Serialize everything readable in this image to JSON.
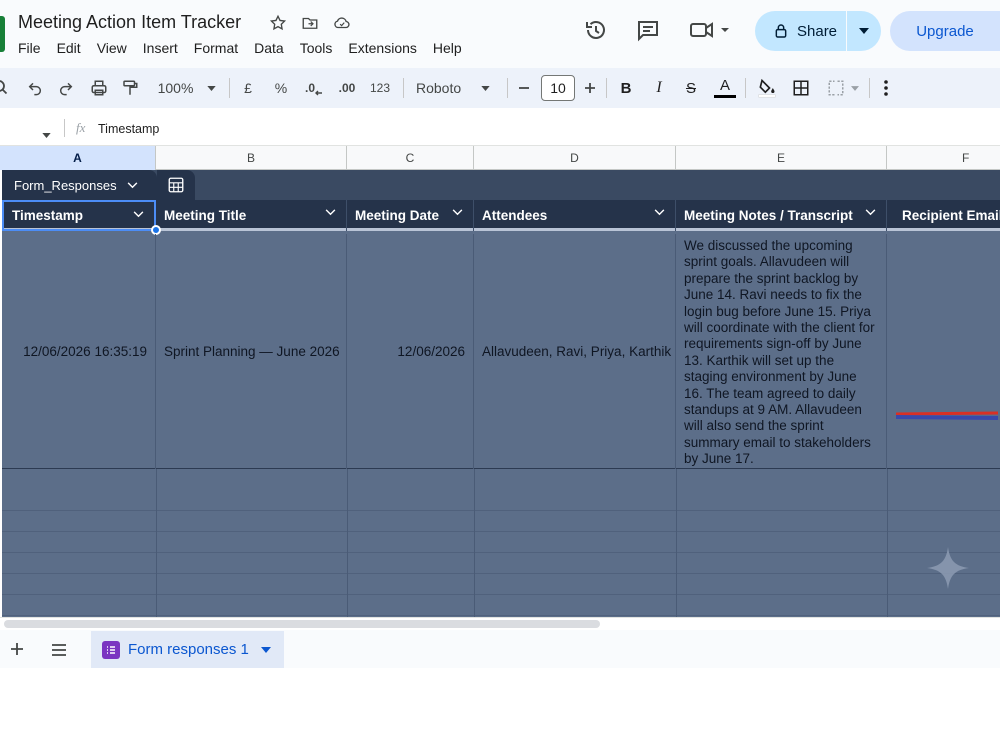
{
  "app": {
    "title": "Meeting Action Item Tracker",
    "menu": [
      "File",
      "Edit",
      "View",
      "Insert",
      "Format",
      "Data",
      "Tools",
      "Extensions",
      "Help"
    ],
    "share_label": "Share",
    "upgrade_label": "Upgrade"
  },
  "toolbar": {
    "zoom": "100%",
    "currency": "£",
    "percent": "%",
    "dec_decrease": ".0",
    "dec_increase": ".00",
    "number_format": "123",
    "font": "Roboto",
    "font_size": "10",
    "bold": "B",
    "italic": "I",
    "strike": "S",
    "text_color": "A"
  },
  "formula_bar": {
    "fx": "fx",
    "content": "Timestamp"
  },
  "columns": [
    "A",
    "B",
    "C",
    "D",
    "E",
    "F"
  ],
  "table": {
    "name": "Form_Responses",
    "headers": [
      "Timestamp",
      "Meeting Title",
      "Meeting Date",
      "Attendees",
      "Meeting Notes / Transcript",
      "Recipient Email"
    ],
    "row": {
      "timestamp": "12/06/2026 16:35:19",
      "meeting_title": "Sprint Planning — June 2026",
      "meeting_date": "12/06/2026",
      "attendees": "Allavudeen, Ravi, Priya, Karthik",
      "notes": "We discussed the upcoming sprint goals. Allavudeen will prepare the sprint backlog by June 14. Ravi needs to fix the login bug before June 15. Priya will coordinate with the client for requirements sign-off by June 13. Karthik will set up the staging environment by June 16. The team agreed to daily standups at 9 AM. Allavudeen will also send the sprint summary email to stakeholders by June 17."
    }
  },
  "sheet_tab": {
    "label": "Form responses 1"
  },
  "colors": {
    "table_header": "#25334a",
    "table_body": "#5c6e89",
    "accent": "#0b57d0",
    "share_bg": "#c2e7ff"
  }
}
